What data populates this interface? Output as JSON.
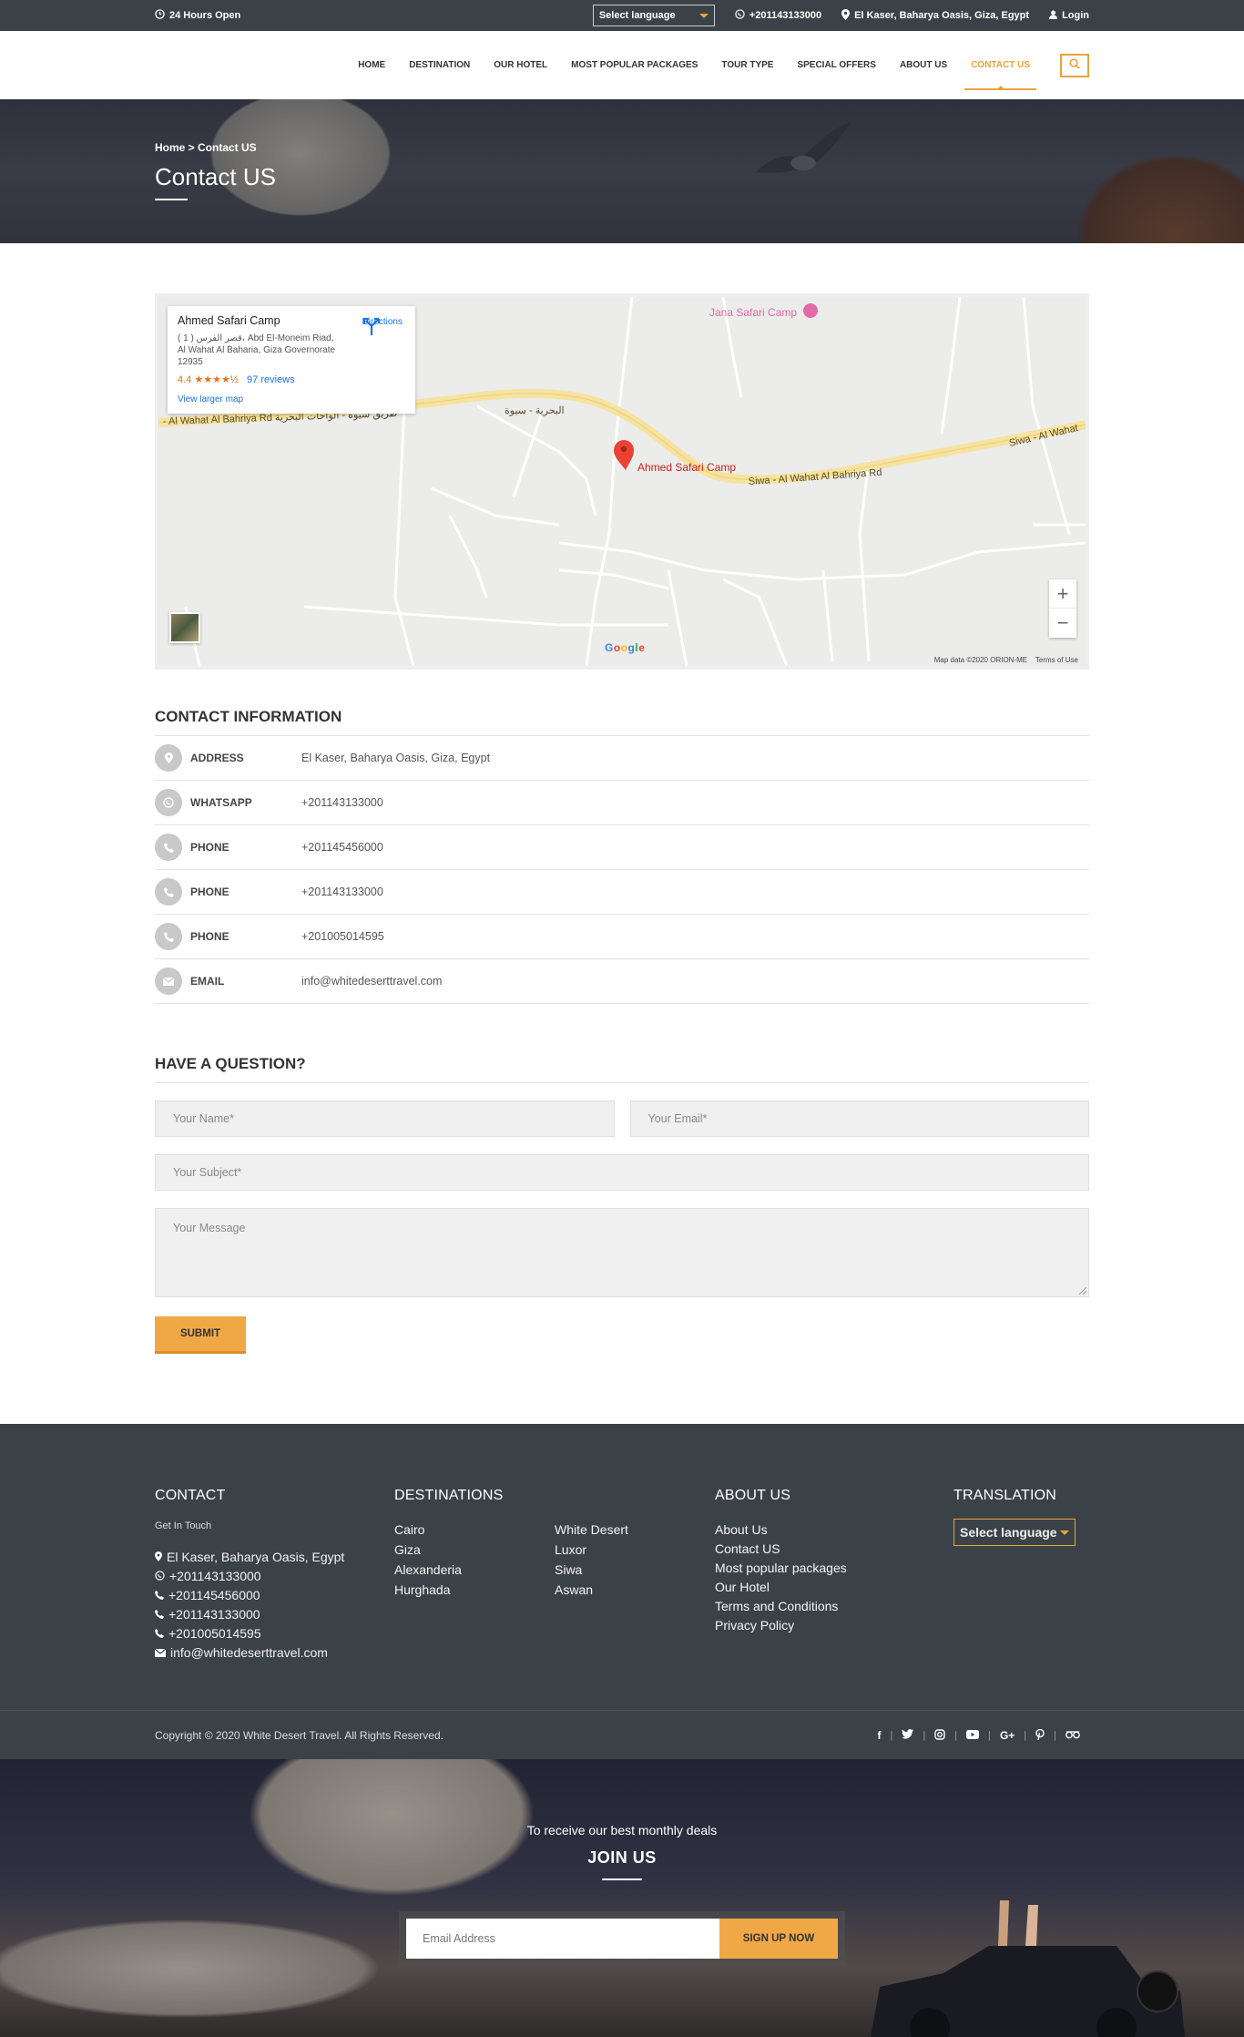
{
  "topbar": {
    "hours": "24 Hours Open",
    "language": "Select language",
    "phone": "+201143133000",
    "location": "El Kaser, Baharya Oasis, Giza, Egypt",
    "login": "Login"
  },
  "nav": {
    "items": [
      "HOME",
      "DESTINATION",
      "OUR HOTEL",
      "MOST POPULAR PACKAGES",
      "TOUR TYPE",
      "SPECIAL OFFERS",
      "ABOUT US",
      "CONTACT US"
    ],
    "active": "CONTACT US"
  },
  "banner": {
    "breadcrumb": "Home > Contact US",
    "title": "Contact US"
  },
  "map": {
    "place_name": "Ahmed Safari Camp",
    "address": "( 1 ) قصر الفرس، Abd El-Moneim Riad, Al Wahat Al Baharia, Giza Governorate 12935",
    "rating": "4.4",
    "stars": "★★★★½",
    "reviews": "97 reviews",
    "larger_map": "View larger map",
    "directions": "Directions",
    "pin_label": "Ahmed Safari Camp",
    "poi_label": "Jana Safari Camp",
    "road_left": "- Al Wahat Al Bahriya Rd طريق سيوة - الواحات البحرية",
    "road_arabic": "البحرية - سيوة",
    "road_right": "Siwa - Al Wahat Al Bahriya Rd",
    "road_far_right": "Siwa - Al Wahat",
    "google": "Google",
    "map_data": "Map data ©2020 ORION-ME",
    "terms": "Terms of Use"
  },
  "contact_info": {
    "title": "CONTACT INFORMATION",
    "rows": [
      {
        "label": "ADDRESS",
        "value": "El Kaser, Baharya Oasis, Giza, Egypt",
        "icon": "map-pin-icon"
      },
      {
        "label": "WHATSAPP",
        "value": "+201143133000",
        "icon": "whatsapp-icon"
      },
      {
        "label": "PHONE",
        "value": "+201145456000",
        "icon": "phone-icon"
      },
      {
        "label": "PHONE",
        "value": "+201143133000",
        "icon": "phone-icon"
      },
      {
        "label": "PHONE",
        "value": "+201005014595",
        "icon": "phone-icon"
      },
      {
        "label": "EMAIL",
        "value": "info@whitedeserttravel.com",
        "icon": "envelope-icon"
      }
    ]
  },
  "form": {
    "title": "HAVE A QUESTION?",
    "name_placeholder": "Your Name*",
    "email_placeholder": "Your Email*",
    "subject_placeholder": "Your Subject*",
    "message_placeholder": "Your Message",
    "submit": "SUBMIT"
  },
  "footer": {
    "contact": {
      "title": "CONTACT",
      "subtitle": "Get In Touch",
      "address": "El Kaser, Baharya Oasis, Egypt",
      "whatsapp": "+201143133000",
      "phones": [
        "+201145456000",
        "+201143133000",
        "+201005014595"
      ],
      "email": "info@whitedeserttravel.com"
    },
    "destinations": {
      "title": "DESTINATIONS",
      "items": [
        "Cairo",
        "White Desert",
        "Giza",
        "Luxor",
        "Alexanderia",
        "Siwa",
        "Hurghada",
        "Aswan"
      ]
    },
    "about": {
      "title": "ABOUT US",
      "items": [
        "About Us",
        "Contact US",
        "Most popular packages",
        "Our Hotel",
        "Terms and Conditions",
        "Privacy Policy"
      ]
    },
    "translation": {
      "title": "TRANSLATION",
      "language": "Select language"
    },
    "copyright": "Copyright © 2020 White Desert Travel. All Rights Reserved.",
    "socials": [
      "f",
      "t",
      "ig",
      "yt",
      "G+",
      "p",
      "ta"
    ]
  },
  "newsletter": {
    "lead": "To receive our best monthly deals",
    "title": "JOIN US",
    "email_placeholder": "Email Address",
    "button": "SIGN UP NOW"
  },
  "colors": {
    "accent": "#e8a33a",
    "dark": "#3b4247",
    "button": "#f0a847"
  }
}
